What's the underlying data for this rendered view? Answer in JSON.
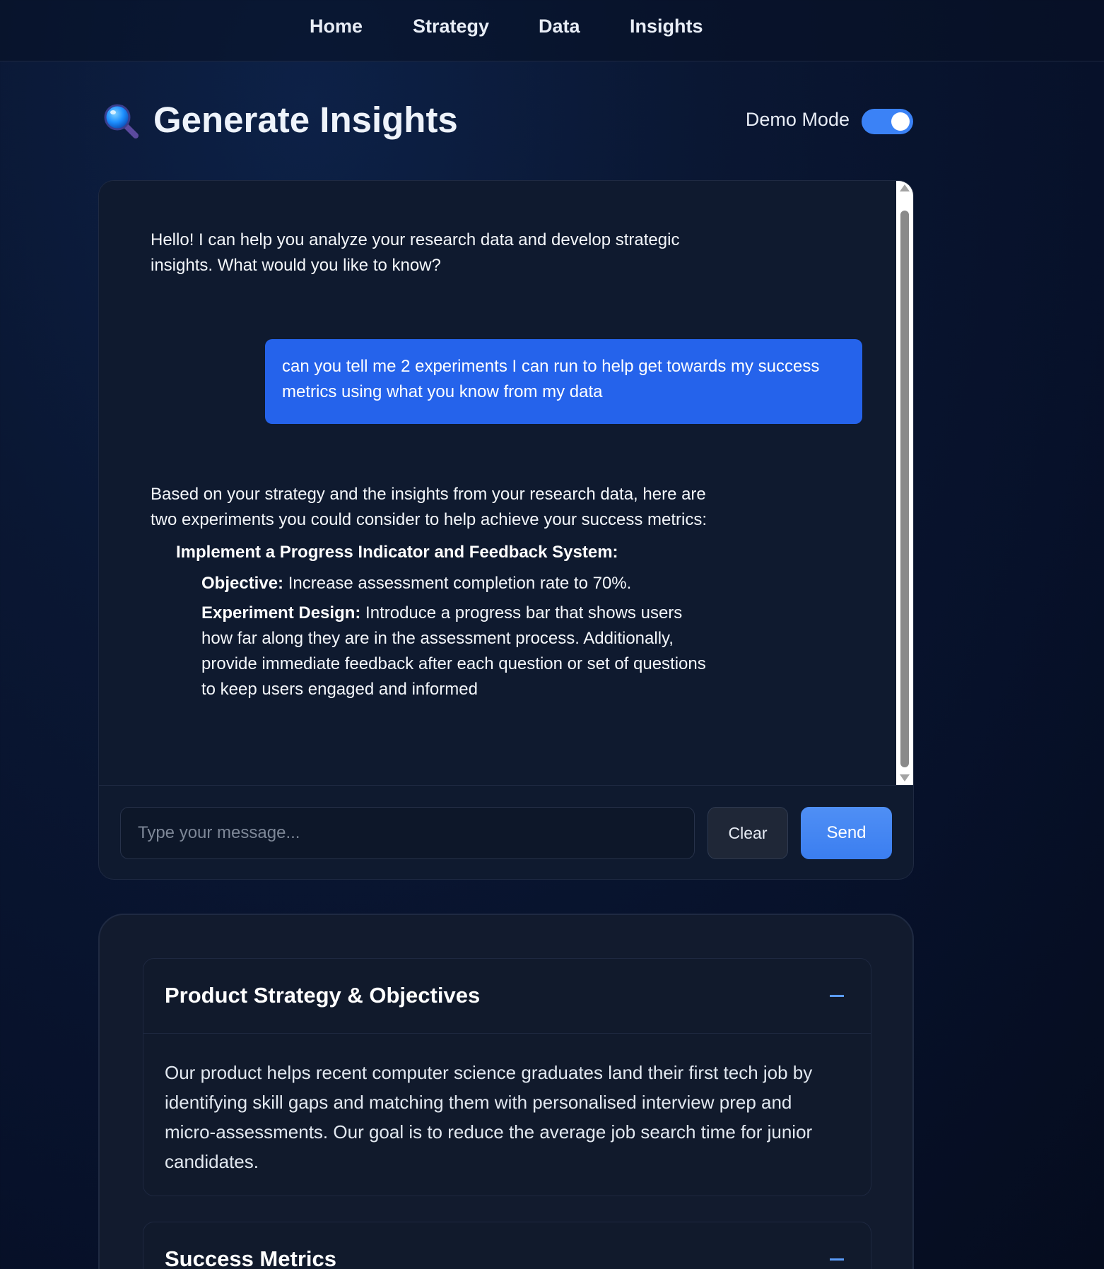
{
  "nav": {
    "items": [
      "Home",
      "Strategy",
      "Data",
      "Insights"
    ]
  },
  "header": {
    "title": "Generate Insights",
    "icon": "magnifying-glass",
    "demo_mode_label": "Demo Mode",
    "demo_mode_on": true
  },
  "chat": {
    "greeting_line1": "Hello! I can help you analyze your research data and develop strategic",
    "greeting_line2": "insights. What would you like to know?",
    "user_line1": "can you tell me 2 experiments I can run to help get towards my success",
    "user_line2": "metrics using what you know from my data",
    "reply_line1": "Based on your strategy and the insights from your research data, here are",
    "reply_line2": "two experiments you could consider to help achieve your success metrics:",
    "experiment_title": "Implement a Progress Indicator and Feedback System:",
    "objective_label": "Objective:",
    "objective_text": " Increase assessment completion rate to 70%.",
    "design_label": "Experiment Design:",
    "design_text1": " Introduce a progress bar that shows users",
    "design_text2": "how far along they are in the assessment process. Additionally,",
    "design_text3": "provide immediate feedback after each question or set of questions",
    "design_text4": "to keep users engaged and informed",
    "input_placeholder": "Type your message...",
    "clear_label": "Clear",
    "send_label": "Send"
  },
  "context": {
    "sections": [
      {
        "title": "Product Strategy & Objectives",
        "body": "Our product helps recent computer science graduates land their first tech job by identifying skill gaps and matching them with personalised interview prep and micro-assessments. Our goal is to reduce the average job search time for junior candidates."
      },
      {
        "title": "Success Metrics"
      }
    ]
  },
  "colors": {
    "accent": "#3b82f6",
    "user_bubble": "#2563eb",
    "background": "#0a1733"
  }
}
